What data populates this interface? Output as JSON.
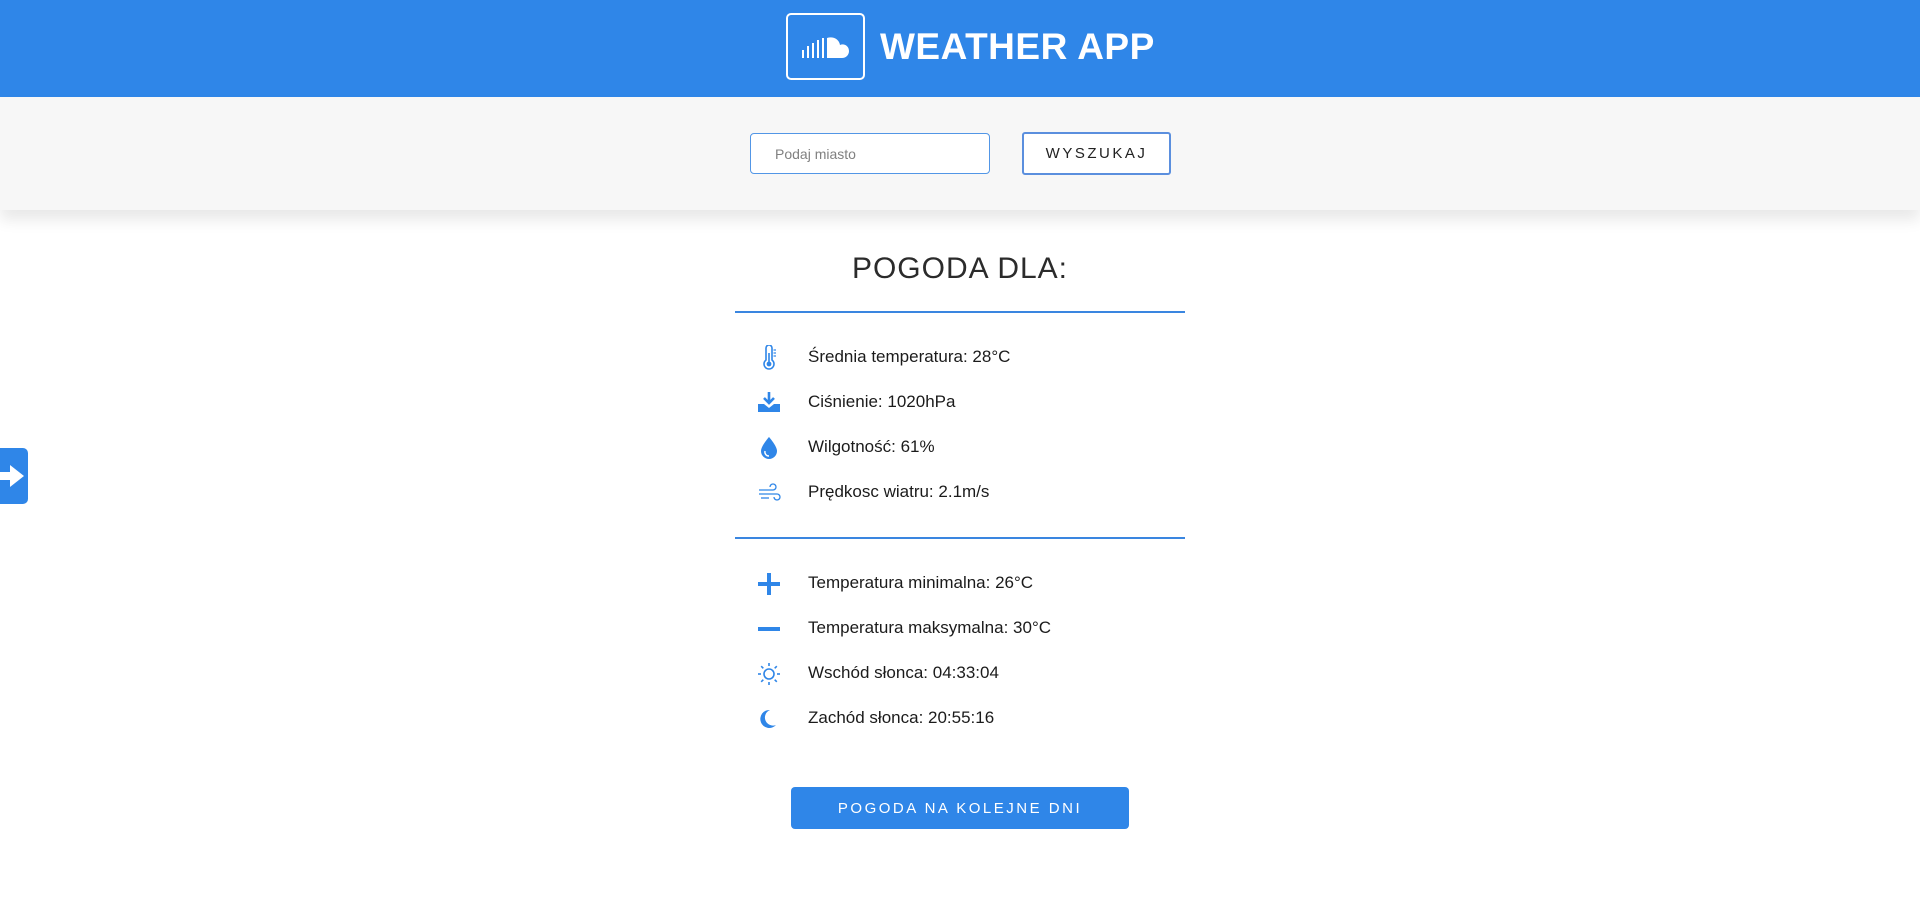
{
  "header": {
    "title": "WEATHER APP",
    "logo_icon": "soundcloud-logo-icon",
    "background_color": "#2f86e8"
  },
  "search": {
    "placeholder": "Podaj miasto",
    "value": "",
    "button_label": "WYSZUKAJ"
  },
  "weather": {
    "title": "POGODA DLA:",
    "current": [
      {
        "icon": "thermometer-icon",
        "label": "Średnia temperatura: ",
        "value": "28°C"
      },
      {
        "icon": "pressure-download-icon",
        "label": "Ciśnienie: ",
        "value": "1020hPa"
      },
      {
        "icon": "droplet-icon",
        "label": "Wilgotność: ",
        "value": "61%"
      },
      {
        "icon": "wind-icon",
        "label": "Prędkosc wiatru: ",
        "value": "2.1m/s"
      }
    ],
    "details": [
      {
        "icon": "plus-icon",
        "label": "Temperatura minimalna: ",
        "value": "26°C"
      },
      {
        "icon": "minus-icon",
        "label": "Temperatura maksymalna: ",
        "value": "30°C"
      },
      {
        "icon": "sun-icon",
        "label": "Wschód słonca: ",
        "value": "04:33:04"
      },
      {
        "icon": "moon-icon",
        "label": "Zachód słonca: ",
        "value": "20:55:16"
      }
    ]
  },
  "forecast_button_label": "POGODA NA KOLEJNE DNI",
  "side_tab_icon": "arrow-right-icon",
  "accent_color": "#2f86e8"
}
